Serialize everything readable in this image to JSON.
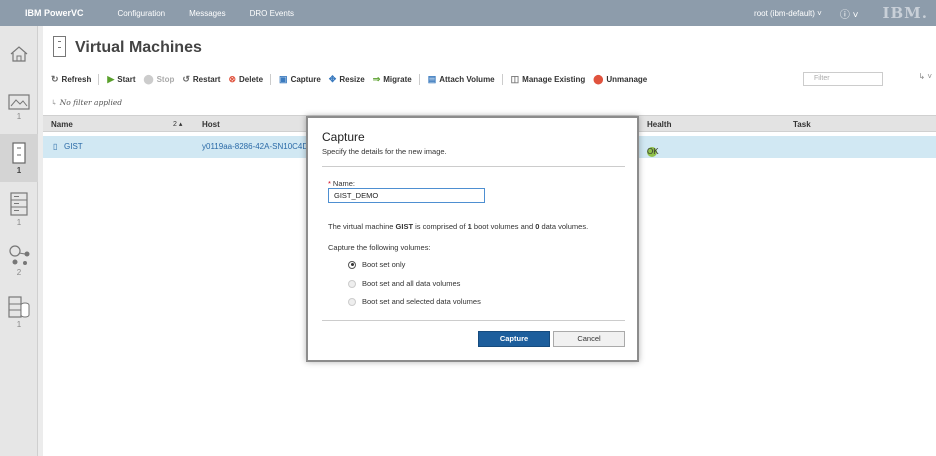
{
  "topbar": {
    "brand": "IBM PowerVC",
    "nav": [
      "Configuration",
      "Messages",
      "DRO Events"
    ],
    "user": "root (ibm-default) ˅",
    "help_icon": "help-icon",
    "logo": "IBM."
  },
  "rail": {
    "items": [
      {
        "icon": "home-icon",
        "count": ""
      },
      {
        "icon": "image-icon",
        "count": "1"
      },
      {
        "icon": "virtual-machine-icon",
        "count": "1"
      },
      {
        "icon": "host-icon",
        "count": "1"
      },
      {
        "icon": "network-icon",
        "count": "2"
      },
      {
        "icon": "storage-icon",
        "count": "1"
      }
    ]
  },
  "page": {
    "title": "Virtual Machines"
  },
  "toolbar": {
    "refresh": "Refresh",
    "start": "Start",
    "stop": "Stop",
    "restart": "Restart",
    "delete": "Delete",
    "capture": "Capture",
    "resize": "Resize",
    "migrate": "Migrate",
    "attach_volume": "Attach Volume",
    "manage_existing": "Manage Existing",
    "unmanage": "Unmanage",
    "filter_placeholder": "Filter"
  },
  "filter_status": "No filter applied",
  "table": {
    "columns": {
      "name": "Name",
      "sort": "2 ▴",
      "host": "Host",
      "health": "Health",
      "task": "Task"
    },
    "rows": [
      {
        "name": "GIST",
        "host": "y0119aa-8286-42A-SN10C4D",
        "health": "OK",
        "task": ""
      }
    ]
  },
  "dialog": {
    "title": "Capture",
    "subtitle": "Specify the details for the new image.",
    "name_label": "Name:",
    "name_value": "GIST_DEMO",
    "info_prefix": "The virtual machine ",
    "info_vm": "GIST",
    "info_mid1": " is comprised of ",
    "info_boot": "1",
    "info_mid2": " boot volumes and ",
    "info_data": "0",
    "info_suffix": " data volumes.",
    "capture_label": "Capture the following volumes:",
    "options": [
      "Boot set only",
      "Boot set and all data volumes",
      "Boot set and selected data volumes"
    ],
    "selected_option": "Boot set only",
    "capture_button": "Capture",
    "cancel_button": "Cancel"
  },
  "colors": {
    "topbar": "#8d9cab",
    "selected_row": "#d1e8f3",
    "primary_button": "#1d5e9c",
    "ok_status": "#8fc14a"
  }
}
